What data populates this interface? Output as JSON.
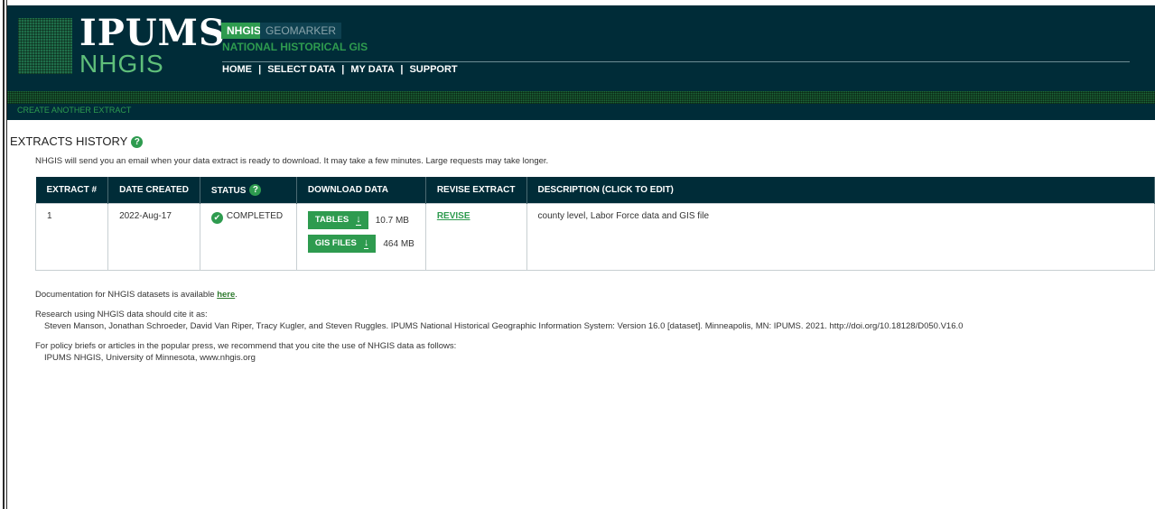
{
  "header": {
    "logo_top": "IPUMS",
    "logo_bottom": "NHGIS",
    "tabs": [
      {
        "label": "NHGIS",
        "active": true
      },
      {
        "label": "GEOMARKER",
        "active": false
      }
    ],
    "subtitle": "NATIONAL HISTORICAL GIS",
    "nav": [
      "HOME",
      "SELECT DATA",
      "MY DATA",
      "SUPPORT"
    ],
    "nav_separator": "|"
  },
  "subnav": {
    "link": "CREATE ANOTHER EXTRACT"
  },
  "history": {
    "title": "EXTRACTS HISTORY",
    "notice": "NHGIS will send you an email when your data extract is ready to download. It may take a few minutes. Large requests may take longer.",
    "columns": [
      "EXTRACT #",
      "DATE CREATED",
      "STATUS",
      "DOWNLOAD DATA",
      "REVISE EXTRACT",
      "DESCRIPTION (CLICK TO EDIT)"
    ],
    "rows": [
      {
        "extract": "1",
        "date": "2022-Aug-17",
        "status": "COMPLETED",
        "downloads": [
          {
            "label": "TABLES",
            "size": "10.7 MB"
          },
          {
            "label": "GIS FILES",
            "size": "464 MB"
          }
        ],
        "revise": "REVISE",
        "description": "county level, Labor Force data and GIS file"
      }
    ]
  },
  "docs": {
    "doc_prefix": "Documentation for NHGIS datasets is available",
    "doc_link": "here",
    "doc_suffix": ".",
    "cite_intro": "Research using NHGIS data should cite it as:",
    "citation": "Steven Manson, Jonathan Schroeder, David Van Riper, Tracy Kugler, and Steven Ruggles. IPUMS National Historical Geographic Information System: Version 16.0 [dataset]. Minneapolis, MN: IPUMS. 2021. http://doi.org/10.18128/D050.V16.0",
    "press_intro": "For policy briefs or articles in the popular press, we recommend that you cite the use of NHGIS data as follows:",
    "press_citation": "IPUMS NHGIS, University of Minnesota, www.nhgis.org"
  },
  "icons": {
    "help": "help-icon",
    "check": "check-circle-icon",
    "download": "download-arrow-icon"
  },
  "colors": {
    "header_bg": "#002c38",
    "accent_green": "#2e9b4f"
  }
}
